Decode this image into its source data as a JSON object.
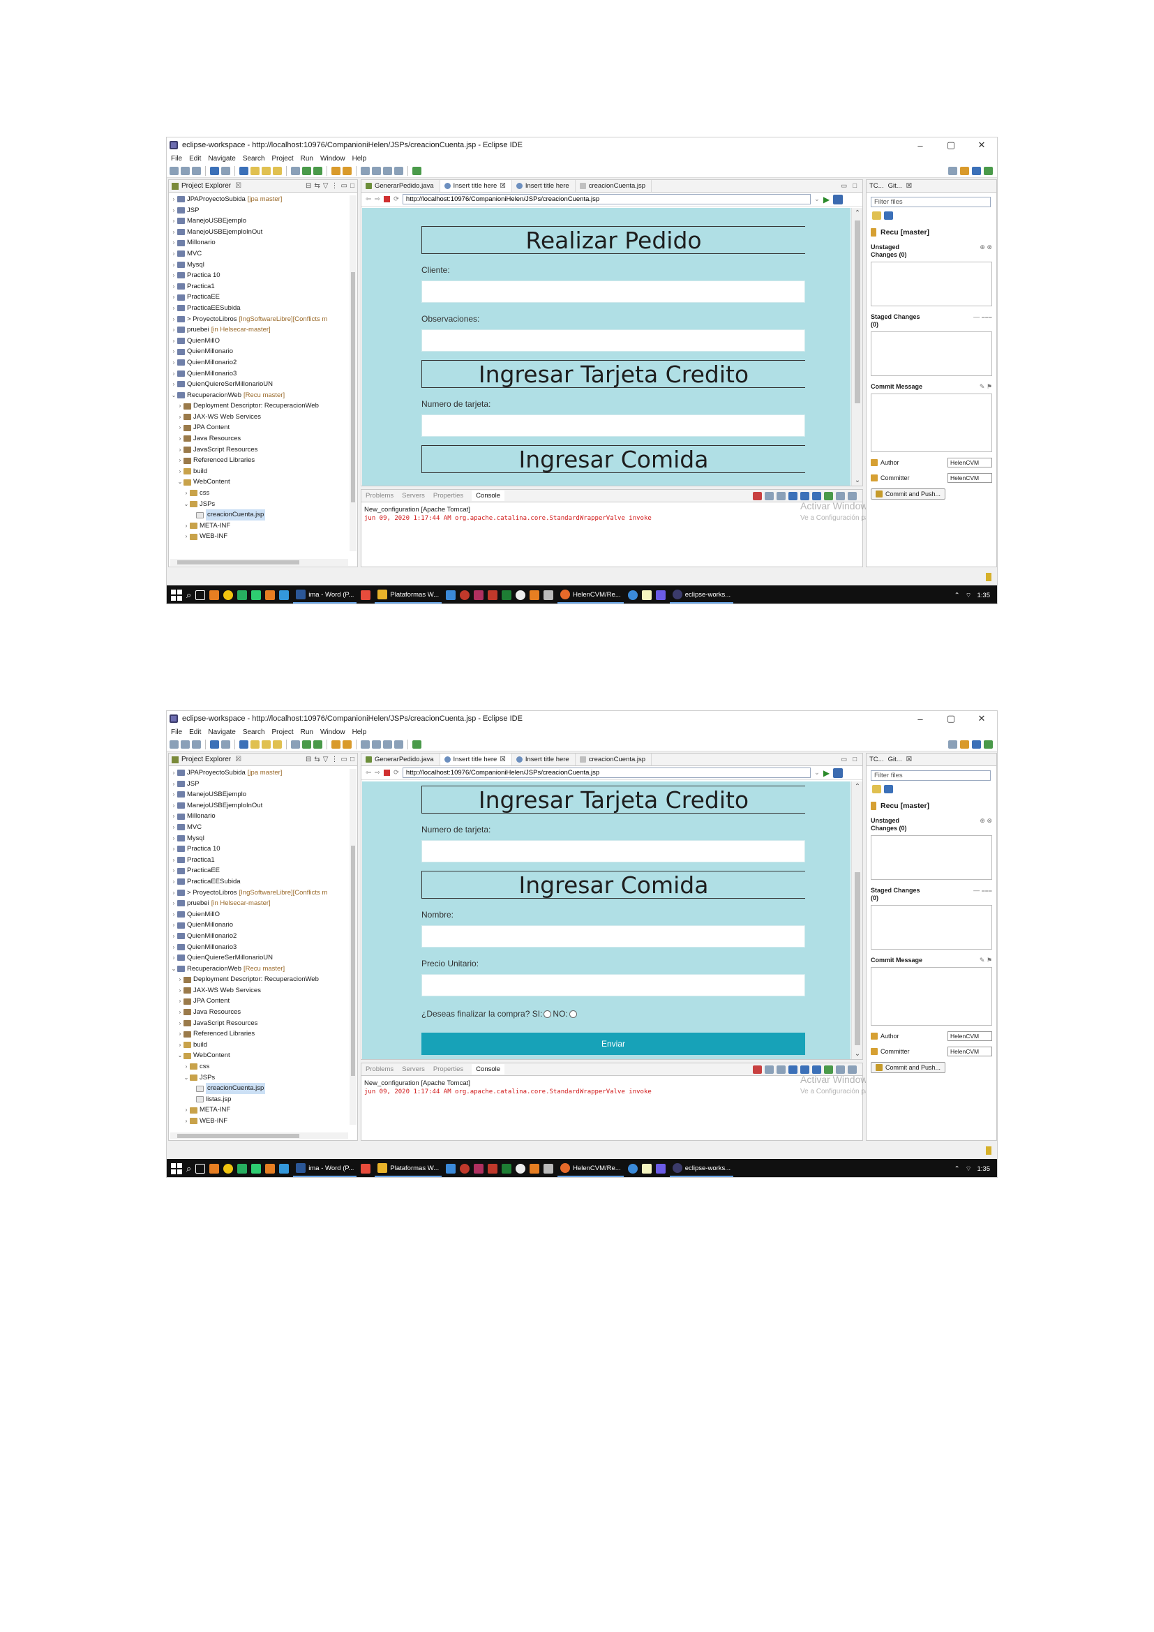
{
  "screens": [
    {
      "window": {
        "title": "eclipse-workspace - http://localhost:10976/CompanioniHelen/JSPs/creacionCuenta.jsp - Eclipse IDE",
        "minimize": "–",
        "maximize": "▢",
        "close": "✕"
      },
      "menu": [
        "File",
        "Edit",
        "Navigate",
        "Search",
        "Project",
        "Run",
        "Window",
        "Help"
      ],
      "explorer": {
        "title": "Project Explorer",
        "items": [
          {
            "arrow": "›",
            "icon": "proj",
            "label": "JPAProyectoSubida",
            "dec": "[jpa master]"
          },
          {
            "arrow": "›",
            "icon": "proj",
            "label": "JSP",
            "dec": ""
          },
          {
            "arrow": "›",
            "icon": "proj",
            "label": "ManejoUSBEjemplo",
            "dec": ""
          },
          {
            "arrow": "›",
            "icon": "proj",
            "label": "ManejoUSBEjemploInOut",
            "dec": ""
          },
          {
            "arrow": "›",
            "icon": "proj",
            "label": "Millonario",
            "dec": ""
          },
          {
            "arrow": "›",
            "icon": "proj",
            "label": "MVC",
            "dec": ""
          },
          {
            "arrow": "›",
            "icon": "proj",
            "label": "Mysql",
            "dec": ""
          },
          {
            "arrow": "›",
            "icon": "proj",
            "label": "Practica 10",
            "dec": ""
          },
          {
            "arrow": "›",
            "icon": "proj",
            "label": "Practica1",
            "dec": ""
          },
          {
            "arrow": "›",
            "icon": "proj",
            "label": "PracticaEE",
            "dec": ""
          },
          {
            "arrow": "›",
            "icon": "proj",
            "label": "PracticaEESubida",
            "dec": ""
          },
          {
            "arrow": "›",
            "icon": "proj",
            "label": "> ProyectoLibros",
            "dec": "[IngSoftwareLibre][Conflicts m"
          },
          {
            "arrow": "›",
            "icon": "proj",
            "label": "pruebei",
            "dec": "[in Helsecar-master]"
          },
          {
            "arrow": "›",
            "icon": "proj",
            "label": "QuienMillO",
            "dec": ""
          },
          {
            "arrow": "›",
            "icon": "proj",
            "label": "QuienMillonario",
            "dec": ""
          },
          {
            "arrow": "›",
            "icon": "proj",
            "label": "QuienMillonario2",
            "dec": ""
          },
          {
            "arrow": "›",
            "icon": "proj",
            "label": "QuienMillonario3",
            "dec": ""
          },
          {
            "arrow": "›",
            "icon": "proj",
            "label": "QuienQuiereSerMillonarioUN",
            "dec": ""
          },
          {
            "arrow": "⌄",
            "icon": "proj",
            "label": "RecuperacionWeb",
            "dec": "[Recu master]"
          },
          {
            "arrow": "›",
            "icon": "lib",
            "label": "Deployment Descriptor: RecuperacionWeb",
            "dec": "",
            "indent": 1
          },
          {
            "arrow": "›",
            "icon": "lib",
            "label": "JAX-WS Web Services",
            "dec": "",
            "indent": 1
          },
          {
            "arrow": "›",
            "icon": "lib",
            "label": "JPA Content",
            "dec": "",
            "indent": 1
          },
          {
            "arrow": "›",
            "icon": "lib",
            "label": "Java Resources",
            "dec": "",
            "indent": 1
          },
          {
            "arrow": "›",
            "icon": "lib",
            "label": "JavaScript Resources",
            "dec": "",
            "indent": 1
          },
          {
            "arrow": "›",
            "icon": "lib",
            "label": "Referenced Libraries",
            "dec": "",
            "indent": 1
          },
          {
            "arrow": "›",
            "icon": "folder",
            "label": "build",
            "dec": "",
            "indent": 1
          },
          {
            "arrow": "⌄",
            "icon": "folder",
            "label": "WebContent",
            "dec": "",
            "indent": 1
          },
          {
            "arrow": "›",
            "icon": "folder",
            "label": "css",
            "dec": "",
            "indent": 2
          },
          {
            "arrow": "⌄",
            "icon": "folder",
            "label": "JSPs",
            "dec": "",
            "indent": 2
          },
          {
            "arrow": "",
            "icon": "file",
            "label": "creacionCuenta.jsp",
            "dec": "",
            "indent": 3,
            "selected": true
          },
          {
            "arrow": "›",
            "icon": "folder",
            "label": "META-INF",
            "dec": "",
            "indent": 2
          },
          {
            "arrow": "›",
            "icon": "folder",
            "label": "WEB-INF",
            "dec": "",
            "indent": 2
          }
        ]
      },
      "editor_tabs": [
        {
          "label": "GenerarPedido.java",
          "kind": "j",
          "active": false
        },
        {
          "label": "Insert title here",
          "kind": "w",
          "active": true,
          "close": "☒"
        },
        {
          "label": "Insert title here",
          "kind": "w",
          "active": false
        },
        {
          "label": "creacionCuenta.jsp",
          "kind": "s",
          "active": false
        }
      ],
      "url": "http://localhost:10976/CompanioniHelen/JSPs/creacionCuenta.jsp",
      "form": [
        {
          "type": "heading",
          "text": "Realizar Pedido"
        },
        {
          "type": "field",
          "label": "Cliente:"
        },
        {
          "type": "field",
          "label": "Observaciones:"
        },
        {
          "type": "heading",
          "text": "Ingresar Tarjeta Credito"
        },
        {
          "type": "field",
          "label": "Numero de tarjeta:"
        },
        {
          "type": "heading",
          "text": "Ingresar Comida"
        }
      ],
      "console": {
        "tabs": [
          "Problems",
          "Servers",
          "Properties",
          "Console"
        ],
        "active_tab": "Console",
        "config": "New_configuration [Apache Tomcat]",
        "log": "jun 09, 2020 1:17:44 AM org.apache.catalina.core.StandardWrapperValve invoke"
      },
      "watermark": {
        "line1": "Activar Windows",
        "line2": "Ve a Configuración para activar Windows."
      },
      "git": {
        "tabs": [
          "TC...",
          "Git..."
        ],
        "filter": "Filter files",
        "repo": "Recu [master]",
        "unstaged": "Unstaged Changes (0)",
        "staged": "Staged Changes (0)",
        "commit_message": "Commit Message",
        "author_label": "Author",
        "author_value": "HelenCVM",
        "committer_label": "Committer",
        "committer_value": "HelenCVM",
        "commit_button": "Commit and Push..."
      },
      "taskbar": {
        "apps": [
          {
            "label": "ima - Word (P...",
            "color": "#2b5797"
          },
          {
            "label": "Plataformas W...",
            "color": "#e8b32a"
          },
          {
            "label": "HelenCVM/Re...",
            "color": "#e66a2a"
          },
          {
            "label": "eclipse-works...",
            "color": "#3b3b6b"
          }
        ],
        "time": "1:35"
      }
    },
    {
      "window": {
        "title": "eclipse-workspace - http://localhost:10976/CompanioniHelen/JSPs/creacionCuenta.jsp - Eclipse IDE",
        "minimize": "–",
        "maximize": "▢",
        "close": "✕"
      },
      "menu": [
        "File",
        "Edit",
        "Navigate",
        "Search",
        "Project",
        "Run",
        "Window",
        "Help"
      ],
      "explorer": {
        "title": "Project Explorer",
        "items": [
          {
            "arrow": "›",
            "icon": "proj",
            "label": "JPAProyectoSubida",
            "dec": "[jpa master]"
          },
          {
            "arrow": "›",
            "icon": "proj",
            "label": "JSP",
            "dec": ""
          },
          {
            "arrow": "›",
            "icon": "proj",
            "label": "ManejoUSBEjemplo",
            "dec": ""
          },
          {
            "arrow": "›",
            "icon": "proj",
            "label": "ManejoUSBEjemploInOut",
            "dec": ""
          },
          {
            "arrow": "›",
            "icon": "proj",
            "label": "Millonario",
            "dec": ""
          },
          {
            "arrow": "›",
            "icon": "proj",
            "label": "MVC",
            "dec": ""
          },
          {
            "arrow": "›",
            "icon": "proj",
            "label": "Mysql",
            "dec": ""
          },
          {
            "arrow": "›",
            "icon": "proj",
            "label": "Practica 10",
            "dec": ""
          },
          {
            "arrow": "›",
            "icon": "proj",
            "label": "Practica1",
            "dec": ""
          },
          {
            "arrow": "›",
            "icon": "proj",
            "label": "PracticaEE",
            "dec": ""
          },
          {
            "arrow": "›",
            "icon": "proj",
            "label": "PracticaEESubida",
            "dec": ""
          },
          {
            "arrow": "›",
            "icon": "proj",
            "label": "> ProyectoLibros",
            "dec": "[IngSoftwareLibre][Conflicts m"
          },
          {
            "arrow": "›",
            "icon": "proj",
            "label": "pruebei",
            "dec": "[in Helsecar-master]"
          },
          {
            "arrow": "›",
            "icon": "proj",
            "label": "QuienMillO",
            "dec": ""
          },
          {
            "arrow": "›",
            "icon": "proj",
            "label": "QuienMillonario",
            "dec": ""
          },
          {
            "arrow": "›",
            "icon": "proj",
            "label": "QuienMillonario2",
            "dec": ""
          },
          {
            "arrow": "›",
            "icon": "proj",
            "label": "QuienMillonario3",
            "dec": ""
          },
          {
            "arrow": "›",
            "icon": "proj",
            "label": "QuienQuiereSerMillonarioUN",
            "dec": ""
          },
          {
            "arrow": "⌄",
            "icon": "proj",
            "label": "RecuperacionWeb",
            "dec": "[Recu master]"
          },
          {
            "arrow": "›",
            "icon": "lib",
            "label": "Deployment Descriptor: RecuperacionWeb",
            "dec": "",
            "indent": 1
          },
          {
            "arrow": "›",
            "icon": "lib",
            "label": "JAX-WS Web Services",
            "dec": "",
            "indent": 1
          },
          {
            "arrow": "›",
            "icon": "lib",
            "label": "JPA Content",
            "dec": "",
            "indent": 1
          },
          {
            "arrow": "›",
            "icon": "lib",
            "label": "Java Resources",
            "dec": "",
            "indent": 1
          },
          {
            "arrow": "›",
            "icon": "lib",
            "label": "JavaScript Resources",
            "dec": "",
            "indent": 1
          },
          {
            "arrow": "›",
            "icon": "lib",
            "label": "Referenced Libraries",
            "dec": "",
            "indent": 1
          },
          {
            "arrow": "›",
            "icon": "folder",
            "label": "build",
            "dec": "",
            "indent": 1
          },
          {
            "arrow": "⌄",
            "icon": "folder",
            "label": "WebContent",
            "dec": "",
            "indent": 1
          },
          {
            "arrow": "›",
            "icon": "folder",
            "label": "css",
            "dec": "",
            "indent": 2
          },
          {
            "arrow": "⌄",
            "icon": "folder",
            "label": "JSPs",
            "dec": "",
            "indent": 2
          },
          {
            "arrow": "",
            "icon": "file",
            "label": "creacionCuenta.jsp",
            "dec": "",
            "indent": 3,
            "selected": true
          },
          {
            "arrow": "",
            "icon": "file",
            "label": "listas.jsp",
            "dec": "",
            "indent": 3
          },
          {
            "arrow": "›",
            "icon": "folder",
            "label": "META-INF",
            "dec": "",
            "indent": 2
          },
          {
            "arrow": "›",
            "icon": "folder",
            "label": "WEB-INF",
            "dec": "",
            "indent": 2
          }
        ]
      },
      "editor_tabs": [
        {
          "label": "GenerarPedido.java",
          "kind": "j",
          "active": false
        },
        {
          "label": "Insert title here",
          "kind": "w",
          "active": true,
          "close": "☒"
        },
        {
          "label": "Insert title here",
          "kind": "w",
          "active": false
        },
        {
          "label": "creacionCuenta.jsp",
          "kind": "s",
          "active": false
        }
      ],
      "url": "http://localhost:10976/CompanioniHelen/JSPs/creacionCuenta.jsp",
      "form": [
        {
          "type": "heading",
          "text": "Ingresar Tarjeta Credito"
        },
        {
          "type": "field",
          "label": "Numero de tarjeta:"
        },
        {
          "type": "heading",
          "text": "Ingresar Comida"
        },
        {
          "type": "field",
          "label": "Nombre:"
        },
        {
          "type": "field",
          "label": "Precio Unitario:"
        },
        {
          "type": "radio",
          "label": "¿Deseas finalizar la compra? SI:",
          "option2": "NO:"
        },
        {
          "type": "button",
          "text": "Enviar"
        }
      ],
      "console": {
        "tabs": [
          "Problems",
          "Servers",
          "Properties",
          "Console"
        ],
        "active_tab": "Console",
        "config": "New_configuration [Apache Tomcat]",
        "log": "jun 09, 2020 1:17:44 AM org.apache.catalina.core.StandardWrapperValve invoke"
      },
      "watermark": {
        "line1": "Activar Windows",
        "line2": "Ve a Configuración para activar Windows."
      },
      "git": {
        "tabs": [
          "TC...",
          "Git..."
        ],
        "filter": "Filter files",
        "repo": "Recu [master]",
        "unstaged": "Unstaged Changes (0)",
        "staged": "Staged Changes (0)",
        "commit_message": "Commit Message",
        "author_label": "Author",
        "author_value": "HelenCVM",
        "committer_label": "Committer",
        "committer_value": "HelenCVM",
        "commit_button": "Commit and Push..."
      },
      "taskbar": {
        "apps": [
          {
            "label": "ima - Word (P...",
            "color": "#2b5797"
          },
          {
            "label": "Plataformas W...",
            "color": "#e8b32a"
          },
          {
            "label": "HelenCVM/Re...",
            "color": "#e66a2a"
          },
          {
            "label": "eclipse-works...",
            "color": "#3b3b6b"
          }
        ],
        "time": "1:35"
      }
    }
  ],
  "colors": {
    "page_bg": "#b0dfe5",
    "button": "#17a2b8",
    "console_error": "#d01818",
    "taskbar": "#101010"
  }
}
